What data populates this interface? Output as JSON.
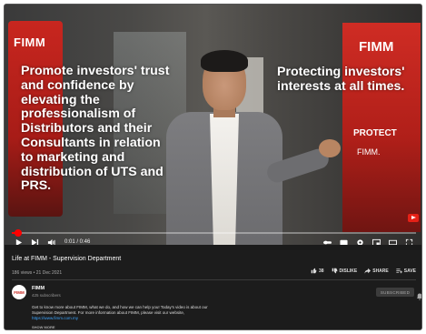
{
  "video": {
    "overlay_left": "Promote investors' trust and confidence by elevating the professionalism of Distributors and their Consultants in relation to marketing and distribution of UTS and PRS.",
    "overlay_right": "Protecting investors' interests at all times.",
    "banner_logo": "FIMM",
    "banner_protect": "PROTECT",
    "banner_logo_small": "FIMM.",
    "progress_fraction": 0.015
  },
  "controls": {
    "time": "0:01 / 0:46"
  },
  "info": {
    "title": "Life at FIMM - Supervision Department",
    "meta": "186 views • 21 Dec 2021",
    "actions": [
      {
        "icon": "thumbs-up-icon",
        "label": "38"
      },
      {
        "icon": "thumbs-down-icon",
        "label": "DISLIKE"
      },
      {
        "icon": "share-icon",
        "label": "SHARE"
      },
      {
        "icon": "save-icon",
        "label": "SAVE"
      }
    ],
    "channel": "FIMM",
    "avatar_text": "FIMM",
    "subscribers": "425 subscribers",
    "subscribe_label": "SUBSCRIBED",
    "description_line1": "Get to know more about FIMM, what we do, and how we can help you! Today's video is about our",
    "description_line2": "Supervision Department. For more information about FIMM, please visit our website,",
    "description_link": "https://www.fimm.com.my",
    "show_more": "SHOW MORE"
  },
  "colors": {
    "accent_red": "#ff0000",
    "banner_red": "#c8261f",
    "link_blue": "#3ea6ff"
  }
}
